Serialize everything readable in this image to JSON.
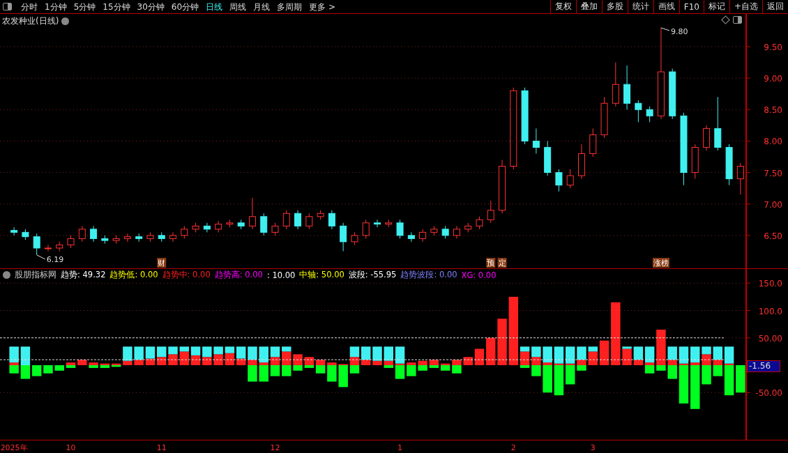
{
  "toolbar": {
    "periods": [
      {
        "label": "分时",
        "selected": false
      },
      {
        "label": "1分钟",
        "selected": false
      },
      {
        "label": "5分钟",
        "selected": false
      },
      {
        "label": "15分钟",
        "selected": false
      },
      {
        "label": "30分钟",
        "selected": false
      },
      {
        "label": "60分钟",
        "selected": false
      },
      {
        "label": "日线",
        "selected": true
      },
      {
        "label": "周线",
        "selected": false
      },
      {
        "label": "月线",
        "selected": false
      },
      {
        "label": "多周期",
        "selected": false
      },
      {
        "label": "更多 >",
        "selected": false
      }
    ],
    "buttons": [
      "复权",
      "叠加",
      "多股",
      "统计",
      "画线",
      "F10",
      "标记",
      "+自选",
      "返回"
    ]
  },
  "price_panel": {
    "title": "农发种业(日线)",
    "chart_data": {
      "type": "candlestick",
      "grid": true,
      "ylim": [
        5.978,
        10.02
      ],
      "categories": [
        null,
        null,
        null,
        null,
        null,
        null,
        null,
        null,
        null,
        null,
        null,
        null,
        null,
        "财",
        null,
        null,
        null,
        null,
        null,
        null,
        null,
        null,
        null,
        null,
        null,
        null,
        null,
        null,
        null,
        null,
        null,
        null,
        null,
        null,
        null,
        null,
        null,
        null,
        null,
        null,
        null,
        null,
        "预",
        "定",
        null,
        null,
        null,
        null,
        null,
        null,
        null,
        null,
        null,
        null,
        null,
        null,
        null,
        "涨榜",
        null,
        null,
        null,
        null,
        null,
        null,
        null
      ],
      "yticks": [
        {
          "value": 6.5,
          "label": "6.50"
        },
        {
          "value": 7.0,
          "label": "7.00"
        },
        {
          "value": 7.5,
          "label": "7.50"
        },
        {
          "value": 8.0,
          "label": "8.00"
        },
        {
          "value": 8.5,
          "label": "8.50"
        },
        {
          "value": 9.0,
          "label": "9.00"
        },
        {
          "value": 9.5,
          "label": "9.50"
        }
      ],
      "ohlc": [
        [
          6.58,
          6.63,
          6.5,
          6.55
        ],
        [
          6.55,
          6.6,
          6.43,
          6.48
        ],
        [
          6.48,
          6.53,
          6.19,
          6.3
        ],
        [
          6.3,
          6.35,
          6.25,
          6.3
        ],
        [
          6.3,
          6.4,
          6.25,
          6.35
        ],
        [
          6.35,
          6.5,
          6.3,
          6.45
        ],
        [
          6.45,
          6.65,
          6.4,
          6.6
        ],
        [
          6.6,
          6.65,
          6.4,
          6.45
        ],
        [
          6.45,
          6.5,
          6.37,
          6.42
        ],
        [
          6.42,
          6.5,
          6.37,
          6.45
        ],
        [
          6.45,
          6.53,
          6.4,
          6.48
        ],
        [
          6.48,
          6.53,
          6.4,
          6.45
        ],
        [
          6.45,
          6.55,
          6.4,
          6.5
        ],
        [
          6.5,
          6.55,
          6.4,
          6.45
        ],
        [
          6.45,
          6.55,
          6.4,
          6.5
        ],
        [
          6.5,
          6.65,
          6.45,
          6.6
        ],
        [
          6.6,
          6.7,
          6.55,
          6.65
        ],
        [
          6.65,
          6.7,
          6.55,
          6.6
        ],
        [
          6.6,
          6.73,
          6.55,
          6.68
        ],
        [
          6.68,
          6.75,
          6.63,
          6.7
        ],
        [
          6.7,
          6.75,
          6.6,
          6.65
        ],
        [
          6.65,
          7.1,
          6.6,
          6.8
        ],
        [
          6.8,
          6.85,
          6.5,
          6.55
        ],
        [
          6.55,
          6.7,
          6.5,
          6.65
        ],
        [
          6.65,
          6.9,
          6.6,
          6.85
        ],
        [
          6.85,
          6.9,
          6.6,
          6.65
        ],
        [
          6.65,
          6.85,
          6.6,
          6.8
        ],
        [
          6.8,
          6.9,
          6.75,
          6.85
        ],
        [
          6.85,
          6.9,
          6.6,
          6.65
        ],
        [
          6.65,
          6.7,
          6.25,
          6.4
        ],
        [
          6.4,
          6.55,
          6.35,
          6.5
        ],
        [
          6.5,
          6.75,
          6.45,
          6.7
        ],
        [
          6.7,
          6.75,
          6.63,
          6.68
        ],
        [
          6.68,
          6.75,
          6.63,
          6.7
        ],
        [
          6.7,
          6.75,
          6.45,
          6.5
        ],
        [
          6.5,
          6.55,
          6.4,
          6.45
        ],
        [
          6.45,
          6.6,
          6.4,
          6.55
        ],
        [
          6.55,
          6.65,
          6.5,
          6.6
        ],
        [
          6.6,
          6.65,
          6.45,
          6.5
        ],
        [
          6.5,
          6.65,
          6.45,
          6.6
        ],
        [
          6.6,
          6.7,
          6.55,
          6.65
        ],
        [
          6.65,
          6.8,
          6.6,
          6.75
        ],
        [
          6.75,
          7.05,
          6.7,
          6.9
        ],
        [
          6.9,
          7.7,
          6.85,
          7.6
        ],
        [
          7.6,
          8.85,
          7.55,
          8.8
        ],
        [
          8.8,
          8.85,
          7.95,
          8.0
        ],
        [
          8.0,
          8.2,
          7.8,
          7.9
        ],
        [
          7.9,
          8.0,
          7.45,
          7.5
        ],
        [
          7.5,
          7.55,
          7.2,
          7.3
        ],
        [
          7.3,
          7.55,
          7.25,
          7.45
        ],
        [
          7.45,
          7.95,
          7.4,
          7.8
        ],
        [
          7.8,
          8.2,
          7.75,
          8.1
        ],
        [
          8.1,
          8.7,
          8.05,
          8.6
        ],
        [
          8.6,
          9.25,
          8.55,
          8.9
        ],
        [
          8.9,
          9.2,
          8.5,
          8.6
        ],
        [
          8.6,
          8.65,
          8.3,
          8.5
        ],
        [
          8.5,
          8.55,
          8.3,
          8.4
        ],
        [
          8.4,
          9.8,
          8.35,
          9.1
        ],
        [
          9.1,
          9.15,
          8.35,
          8.4
        ],
        [
          8.4,
          8.45,
          7.3,
          7.5
        ],
        [
          7.5,
          7.95,
          7.4,
          7.9
        ],
        [
          7.9,
          8.25,
          7.85,
          8.2
        ],
        [
          8.2,
          8.7,
          7.85,
          7.9
        ],
        [
          7.9,
          7.95,
          7.3,
          7.4
        ],
        [
          7.4,
          7.65,
          7.15,
          7.6
        ]
      ],
      "annotations": [
        "9.80",
        "6.19"
      ]
    }
  },
  "indicator_panel": {
    "legend": [
      {
        "text": "股朋指标网"
      },
      {
        "text": "趋势: 49.32",
        "color": "#ffffff"
      },
      {
        "text": "趋势低: 0.00",
        "color": "#ffff00"
      },
      {
        "text": "趋势中: 0.00",
        "color": "#ff2020"
      },
      {
        "text": "趋势高: 0.00",
        "color": "#ff00ff"
      },
      {
        "text": ": 10.00",
        "color": "#ffffff"
      },
      {
        "text": "中轴: 50.00",
        "color": "#ffff00"
      },
      {
        "text": "波段: -55.95",
        "color": "#ffffff"
      },
      {
        "text": "趋势波段: 0.00",
        "color": "#8080ff"
      },
      {
        "text": "XG: 0.00",
        "color": "#ff00ff"
      }
    ],
    "last_value": "-1.56",
    "chart_data": {
      "type": "bar",
      "stacked": true,
      "grid": true,
      "ylim": [
        -136.3,
        175.8
      ],
      "categories": [
        "2025年",
        null,
        null,
        null,
        null,
        "10",
        null,
        null,
        null,
        null,
        null,
        null,
        null,
        "11",
        null,
        null,
        null,
        null,
        null,
        null,
        null,
        null,
        null,
        "12",
        null,
        null,
        null,
        null,
        null,
        null,
        null,
        null,
        null,
        null,
        "1",
        null,
        null,
        null,
        null,
        null,
        null,
        null,
        null,
        null,
        "2",
        null,
        null,
        null,
        null,
        null,
        null,
        "3",
        null,
        null,
        null,
        null,
        null,
        null,
        null,
        null,
        null,
        null,
        null,
        null,
        null
      ],
      "yticks": [
        {
          "value": -50,
          "label": "-50.00"
        },
        {
          "value": 50,
          "label": "50.00"
        },
        {
          "value": 100,
          "label": "100.0"
        },
        {
          "value": 150,
          "label": "150.0"
        }
      ],
      "ref_lines": [
        {
          "axis": "y",
          "value": 50
        },
        {
          "axis": "y",
          "value": 10
        }
      ],
      "series": [
        {
          "color": "#ff2020",
          "values": [
            5,
            0,
            0,
            0,
            0,
            5,
            10,
            5,
            3,
            3,
            8,
            10,
            12,
            15,
            20,
            25,
            18,
            15,
            20,
            22,
            12,
            10,
            5,
            15,
            25,
            20,
            15,
            10,
            5,
            2,
            15,
            10,
            8,
            8,
            3,
            5,
            8,
            10,
            3,
            10,
            15,
            30,
            50,
            85,
            125,
            25,
            15,
            5,
            3,
            3,
            10,
            25,
            45,
            115,
            30,
            10,
            5,
            65,
            10,
            3,
            5,
            20,
            10,
            3,
            0
          ]
        },
        {
          "color": "#40f0f0",
          "values": [
            29,
            34,
            null,
            null,
            null,
            null,
            null,
            null,
            null,
            null,
            26,
            24,
            22,
            19,
            14,
            9,
            16,
            19,
            14,
            12,
            22,
            24,
            29,
            19,
            9,
            null,
            null,
            null,
            null,
            null,
            19,
            24,
            26,
            26,
            31,
            null,
            null,
            null,
            null,
            null,
            null,
            null,
            null,
            null,
            null,
            9,
            19,
            29,
            31,
            31,
            24,
            9,
            null,
            null,
            4,
            24,
            29,
            null,
            24,
            31,
            29,
            14,
            24,
            31,
            null
          ]
        },
        {
          "color": "#00ff20",
          "values": [
            -15,
            -25,
            -20,
            -15,
            -10,
            -5,
            0,
            -5,
            -5,
            -3,
            0,
            0,
            0,
            0,
            0,
            0,
            0,
            0,
            0,
            0,
            0,
            -30,
            -30,
            -20,
            -20,
            -10,
            -5,
            -15,
            -30,
            -40,
            -15,
            0,
            0,
            -5,
            -25,
            -20,
            -10,
            -5,
            -10,
            -15,
            0,
            0,
            0,
            0,
            0,
            -5,
            -20,
            -50,
            -55,
            -35,
            -10,
            0,
            0,
            0,
            0,
            0,
            -15,
            -10,
            -25,
            -70,
            -80,
            -35,
            -20,
            -55,
            -50
          ]
        }
      ]
    }
  }
}
